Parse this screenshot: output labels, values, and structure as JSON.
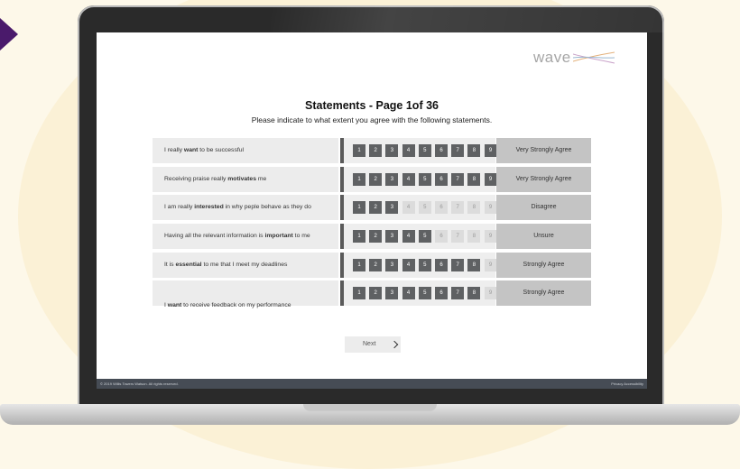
{
  "brand": {
    "logo_text": "wave"
  },
  "page": {
    "title": "Statements - Page 1of 36",
    "instruction": "Please indicate to what extent you agree with the following statements."
  },
  "scale_labels": [
    "1",
    "2",
    "3",
    "4",
    "5",
    "6",
    "7",
    "8",
    "9"
  ],
  "statements": [
    {
      "parts": [
        "I really ",
        "want",
        " to be successful"
      ],
      "selected": 9,
      "answer": "Very Strongly Agree"
    },
    {
      "parts": [
        "Receiving praise really ",
        "motivates",
        " me"
      ],
      "selected": 9,
      "answer": "Very Strongly Agree"
    },
    {
      "parts": [
        "I am really ",
        "interested",
        " in why peple behave as they do"
      ],
      "selected": 3,
      "answer": "Disagree"
    },
    {
      "parts": [
        "Having all the relevant information is ",
        "important",
        " to me"
      ],
      "selected": 5,
      "answer": "Unsure"
    },
    {
      "parts": [
        "It is ",
        "essential",
        " to me that I meet my deadlines"
      ],
      "selected": 8,
      "answer": "Strongly Agree"
    },
    {
      "parts": [
        "I ",
        "want",
        " to receive feedback on my performance"
      ],
      "selected": 8,
      "answer": "Strongly Agree"
    }
  ],
  "next_label": "Next",
  "footer": {
    "copyright": "© 2019 Willis Towers Watson. All rights reserved.",
    "links": "Privacy Accessibility"
  },
  "colors": {
    "selected_box": "#5f6163",
    "unselected_box": "#dcdcdc",
    "accent": "#4a1a6b"
  }
}
